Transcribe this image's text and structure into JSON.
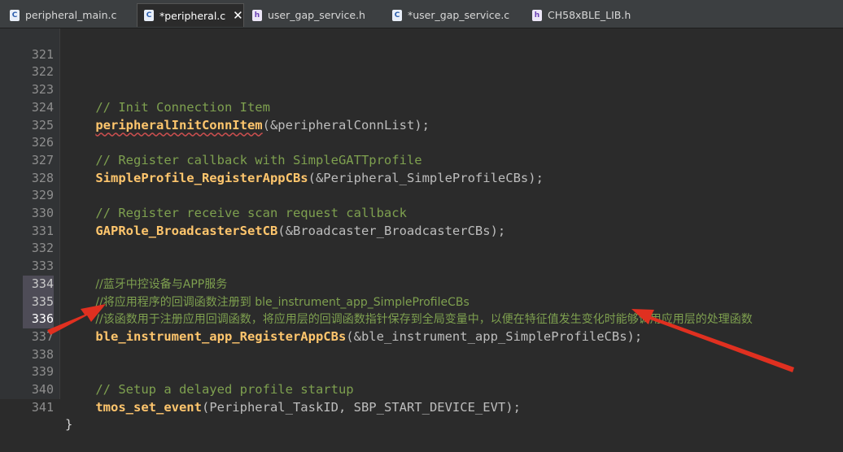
{
  "tabs": [
    {
      "label": "peripheral_main.c",
      "icon": "c-file-icon"
    },
    {
      "label": "*peripheral.c",
      "icon": "c-file-icon",
      "active": true
    },
    {
      "label": "user_gap_service.h",
      "icon": "h-file-icon"
    },
    {
      "label": "*user_gap_service.c",
      "icon": "c-file-icon"
    },
    {
      "label": "CH58xBLE_LIB.h",
      "icon": "h-file-icon"
    }
  ],
  "icons": {
    "c_file": "C",
    "h_file": "h",
    "close": "✕"
  },
  "colors": {
    "comment": "#7ea04f",
    "function": "#ffc66d",
    "arrow": "#e03020"
  },
  "lines": [
    {
      "num": "321"
    },
    {
      "num": "322"
    },
    {
      "num": "323",
      "comment": "// Init Connection Item"
    },
    {
      "num": "324",
      "fn": "peripheralInitConnItem",
      "rest": "(&peripheralConnList);"
    },
    {
      "num": "325"
    },
    {
      "num": "326",
      "comment": "// Register callback with SimpleGATTprofile"
    },
    {
      "num": "327",
      "fn": "SimpleProfile_RegisterAppCBs",
      "rest": "(&Peripheral_SimpleProfileCBs);"
    },
    {
      "num": "328"
    },
    {
      "num": "329",
      "comment": "// Register receive scan request callback"
    },
    {
      "num": "330",
      "fn": "GAPRole_BroadcasterSetCB",
      "rest": "(&Broadcaster_BroadcasterCBs);"
    },
    {
      "num": "331"
    },
    {
      "num": "332"
    },
    {
      "num": "333",
      "comment": "//蓝牙中控设备与APP服务"
    },
    {
      "num": "334",
      "comment": "//将应用程序的回调函数注册到 ble_instrument_app_SimpleProfileCBs"
    },
    {
      "num": "335",
      "comment": "//该函数用于注册应用回调函数，将应用层的回调函数指针保存到全局变量中，以便在特征值发生变化时能够调用应用层的处理函数"
    },
    {
      "num": "336",
      "fn": "ble_instrument_app_RegisterAppCBs",
      "rest": "(&ble_instrument_app_SimpleProfileCBs);"
    },
    {
      "num": "337"
    },
    {
      "num": "338"
    },
    {
      "num": "339",
      "comment": "// Setup a delayed profile startup"
    },
    {
      "num": "340",
      "fn": "tmos_set_event",
      "rest": "(Peripheral_TaskID, SBP_START_DEVICE_EVT);"
    },
    {
      "num": "341",
      "brace": "}"
    }
  ]
}
